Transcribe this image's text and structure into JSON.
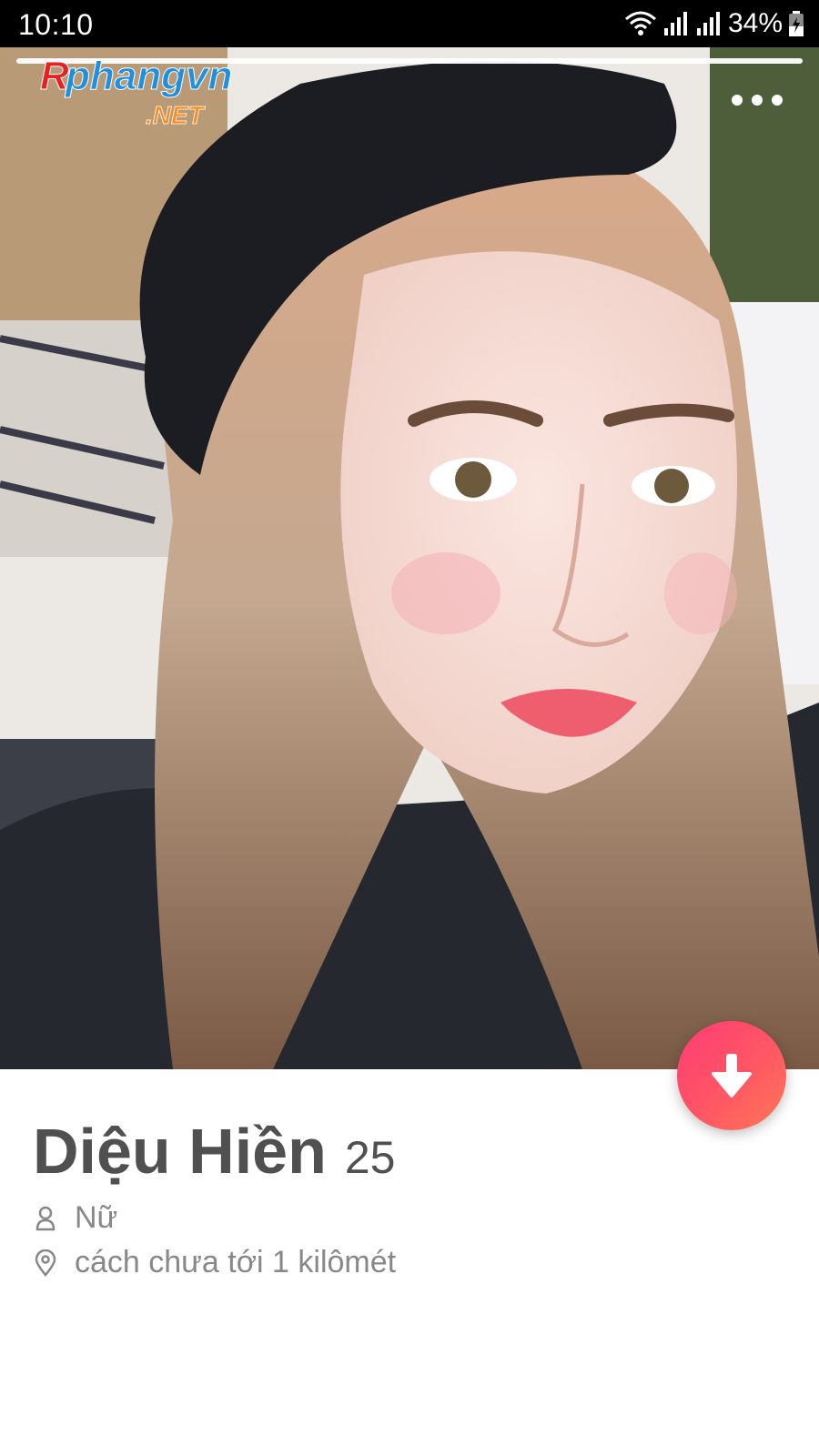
{
  "status_bar": {
    "time": "10:10",
    "battery_percent": "34%"
  },
  "photo": {
    "watermark": {
      "brand": "Rphangvn",
      "suffix": ".NET"
    },
    "progress_fraction": 1.0
  },
  "profile": {
    "name": "Diệu Hiền",
    "age": "25",
    "gender": "Nữ",
    "distance": "cách chưa tới 1 kilômét"
  },
  "colors": {
    "fab_gradient_start": "#fd3b74",
    "fab_gradient_end": "#ff7854",
    "text_primary": "#505050",
    "text_secondary": "#888888"
  },
  "icons": {
    "more": "more-dots-icon",
    "expand": "arrow-down-icon",
    "gender": "person-icon",
    "location": "location-pin-icon"
  }
}
